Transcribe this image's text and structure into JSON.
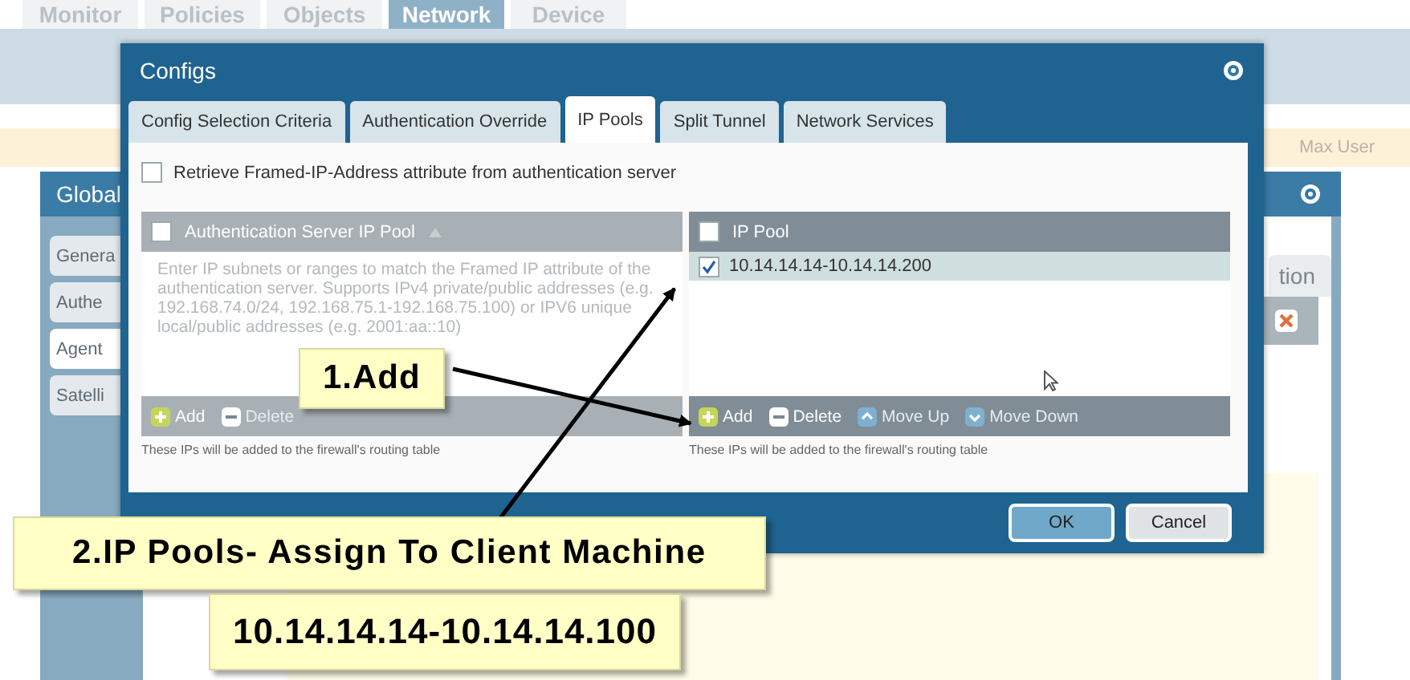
{
  "nav_tabs": [
    {
      "label": "Monitor",
      "selected": false
    },
    {
      "label": "Policies",
      "selected": false
    },
    {
      "label": "Objects",
      "selected": false
    },
    {
      "label": "Network",
      "selected": true
    },
    {
      "label": "Device",
      "selected": false
    }
  ],
  "banner": {
    "column": "Max User"
  },
  "panel": {
    "title": "Global",
    "side_tabs": [
      {
        "label": "Genera",
        "selected": false
      },
      {
        "label": "Authe",
        "selected": false
      },
      {
        "label": "Agent",
        "selected": true
      },
      {
        "label": "Satelli",
        "selected": false
      }
    ],
    "right_tab": "tion"
  },
  "dialog": {
    "title": "Configs",
    "tabs": [
      {
        "label": "Config Selection Criteria",
        "selected": false
      },
      {
        "label": "Authentication Override",
        "selected": false
      },
      {
        "label": "IP Pools",
        "selected": true
      },
      {
        "label": "Split Tunnel",
        "selected": false
      },
      {
        "label": "Network Services",
        "selected": false
      }
    ],
    "retrieve_checkbox": {
      "label": "Retrieve Framed-IP-Address attribute from authentication server",
      "checked": false
    },
    "auth_pool": {
      "header": "Authentication Server IP Pool",
      "header_checked": false,
      "placeholder": "Enter IP subnets or ranges to match the Framed IP attribute of the authentication server. Supports IPv4 private/public addresses (e.g. 192.168.74.0/24, 192.168.75.1-192.168.75.100) or IPV6 unique local/public addresses (e.g. 2001:aa::10)",
      "buttons": [
        {
          "label": "Add",
          "kind": "add",
          "disabled": false
        },
        {
          "label": "Delete",
          "kind": "delete",
          "disabled": true
        }
      ],
      "note": "These IPs will be added to the firewall's routing table"
    },
    "ip_pool": {
      "header": "IP Pool",
      "header_checked": false,
      "rows": [
        {
          "value": "10.14.14.14-10.14.14.200",
          "checked": true
        }
      ],
      "buttons": [
        {
          "label": "Add",
          "kind": "add",
          "disabled": false
        },
        {
          "label": "Delete",
          "kind": "delete",
          "disabled": false
        },
        {
          "label": "Move Up",
          "kind": "up",
          "disabled": true
        },
        {
          "label": "Move Down",
          "kind": "down",
          "disabled": true
        }
      ],
      "note": "These IPs will be added to the firewall's routing table"
    },
    "buttons": [
      {
        "label": "OK",
        "primary": true
      },
      {
        "label": "Cancel",
        "primary": false
      }
    ]
  },
  "callouts": [
    {
      "text": "1.Add"
    },
    {
      "text": "2.IP Pools- Assign To Client Machine"
    },
    {
      "text": "10.14.14.14-10.14.14.100"
    }
  ]
}
